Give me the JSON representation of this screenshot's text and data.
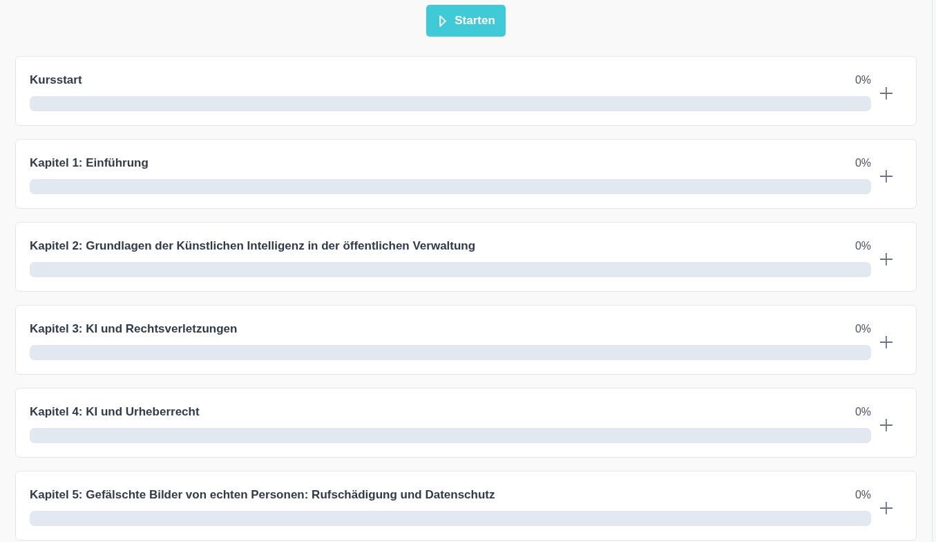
{
  "start_button": {
    "label": "Starten"
  },
  "chapters": [
    {
      "title": "Kursstart",
      "percent": "0%",
      "level": 0,
      "expanded": false
    },
    {
      "title": "Kapitel 1: Einführung",
      "percent": "0%",
      "level": 0,
      "expanded": false
    },
    {
      "title": "Kapitel 2: Grundlagen der Künstlichen Intelligenz in der öffentlichen Verwaltung",
      "percent": "0%",
      "level": 0,
      "expanded": false
    },
    {
      "title": "Kapitel 3: KI und Rechtsverletzungen",
      "percent": "0%",
      "level": 0,
      "expanded": false
    },
    {
      "title": "Kapitel 4: KI und Urheberrecht",
      "percent": "0%",
      "level": 0,
      "expanded": false
    },
    {
      "title": "Kapitel 5: Gefälschte Bilder von echten Personen: Rufschädigung und Datenschutz",
      "percent": "0%",
      "level": 0,
      "expanded": false
    }
  ]
}
